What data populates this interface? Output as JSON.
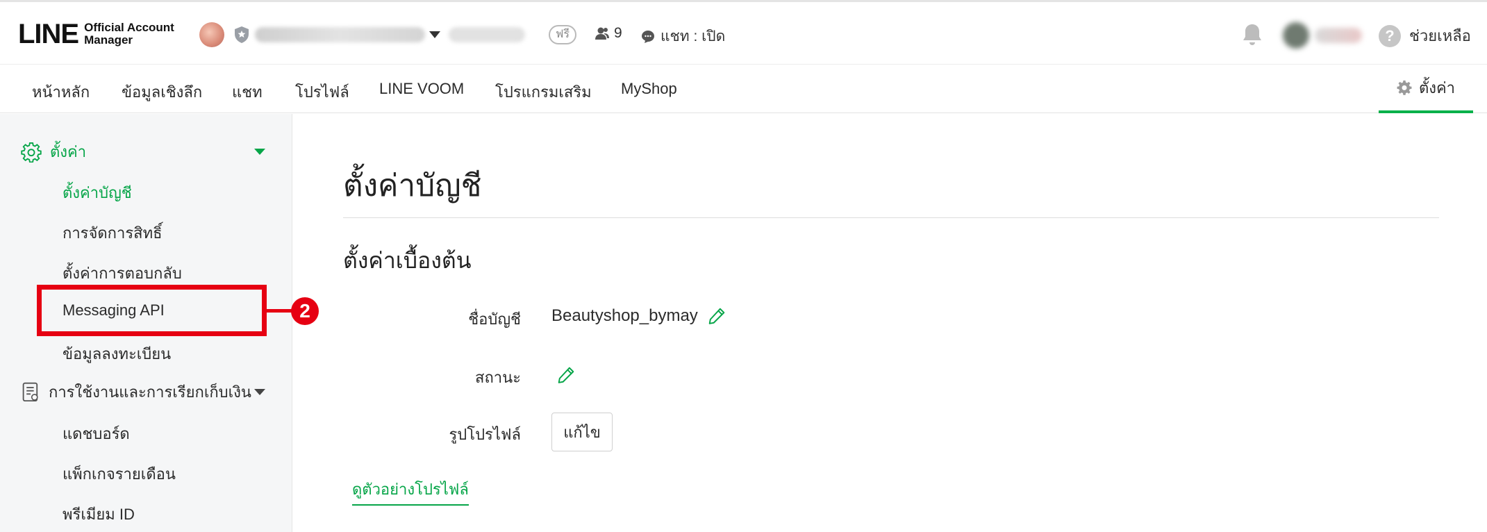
{
  "header": {
    "logo_main": "LINE",
    "logo_sub_line1": "Official Account",
    "logo_sub_line2": "Manager",
    "plan_badge": "ฟรี",
    "friends_count": "9",
    "chat_status": "แชท : เปิด",
    "help_label": "ช่วยเหลือ"
  },
  "nav": {
    "items": [
      "หน้าหลัก",
      "ข้อมูลเชิงลึก",
      "แชท",
      "โปรไฟล์",
      "LINE VOOM",
      "โปรแกรมเสริม",
      "MyShop"
    ],
    "settings_label": "ตั้งค่า"
  },
  "sidebar": {
    "group_settings": "ตั้งค่า",
    "settings_items": [
      "ตั้งค่าบัญชี",
      "การจัดการสิทธิ์",
      "ตั้งค่าการตอบกลับ",
      "Messaging API",
      "ข้อมูลลงทะเบียน"
    ],
    "group_usage": "การใช้งานและการเรียกเก็บเงิน",
    "usage_items": [
      "แดชบอร์ด",
      "แพ็กเกจรายเดือน",
      "พรีเมียม ID"
    ],
    "step_marker": "2"
  },
  "content": {
    "page_title": "ตั้งค่าบัญชี",
    "section_title": "ตั้งค่าเบื้องต้น",
    "account_name_label": "ชื่อบัญชี",
    "account_name_value": "Beautyshop_bymay",
    "status_label": "สถานะ",
    "profile_image_label": "รูปโปรไฟล์",
    "edit_button": "แก้ไข",
    "preview_link": "ดูตัวอย่างโปรไฟล์"
  },
  "colors": {
    "accent_green": "#06b14a",
    "highlight_red": "#e60012"
  }
}
